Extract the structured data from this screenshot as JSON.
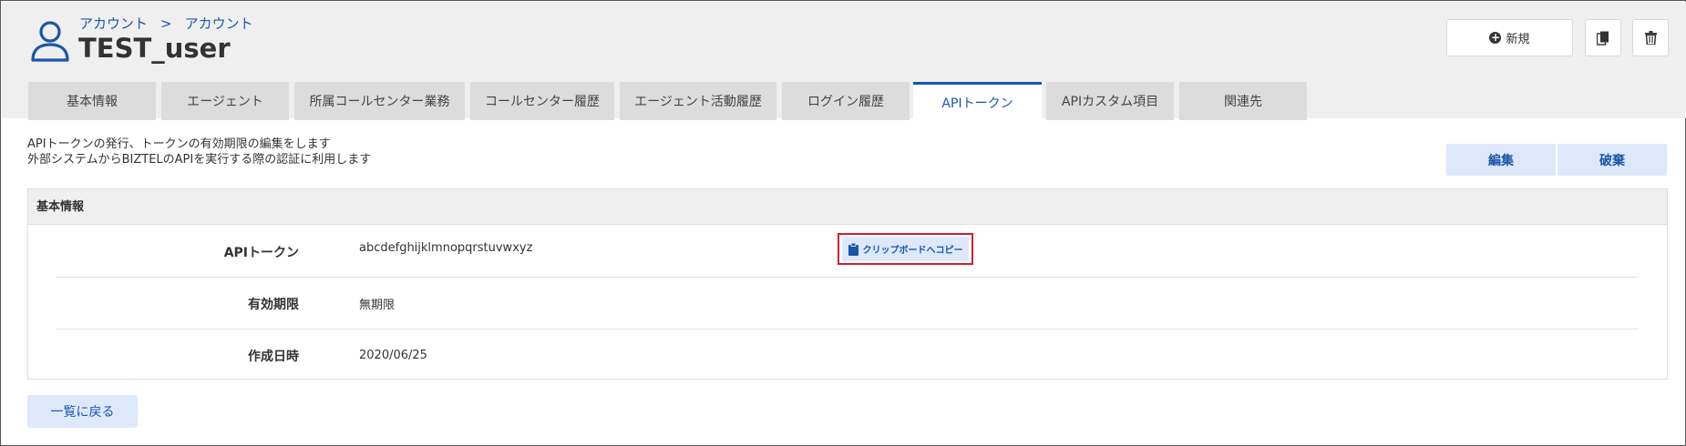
{
  "breadcrumb": [
    "アカウント",
    "アカウント"
  ],
  "breadcrumb_separator": ">",
  "title": "TEST_user",
  "toolbar": {
    "new_label": "新規",
    "copy_icon": "copy-icon",
    "trash_icon": "trash-icon"
  },
  "tabs": [
    {
      "label": "基本情報",
      "active": false
    },
    {
      "label": "エージェント",
      "active": false
    },
    {
      "label": "所属コールセンター業務",
      "active": false
    },
    {
      "label": "コールセンター履歴",
      "active": false
    },
    {
      "label": "エージェント活動履歴",
      "active": false
    },
    {
      "label": "ログイン履歴",
      "active": false
    },
    {
      "label": "APIトークン",
      "active": true
    },
    {
      "label": "APIカスタム項目",
      "active": false
    },
    {
      "label": "関連先",
      "active": false
    }
  ],
  "description": {
    "line1": "APIトークンの発行、トークンの有効期限の編集をします",
    "line2": "外部システムからBIZTELのAPIを実行する際の認証に利用します"
  },
  "actions": {
    "edit": "編集",
    "discard": "破棄"
  },
  "panel": {
    "title": "基本情報",
    "rows": [
      {
        "label": "APIトークン",
        "value": "abcdefghijklmnopqrstuvwxyz"
      },
      {
        "label": "有効期限",
        "value": "無期限"
      },
      {
        "label": "作成日時",
        "value": "2020/06/25"
      }
    ],
    "copy_button_label": "クリップボードへコピー"
  },
  "back_label": "一覧に戻る",
  "colors": {
    "accent": "#1a56a8",
    "button_bg": "#dde8fb",
    "highlight_border": "#d0202a",
    "header_bg": "#efefef",
    "tab_bg": "#dcdcdc"
  }
}
